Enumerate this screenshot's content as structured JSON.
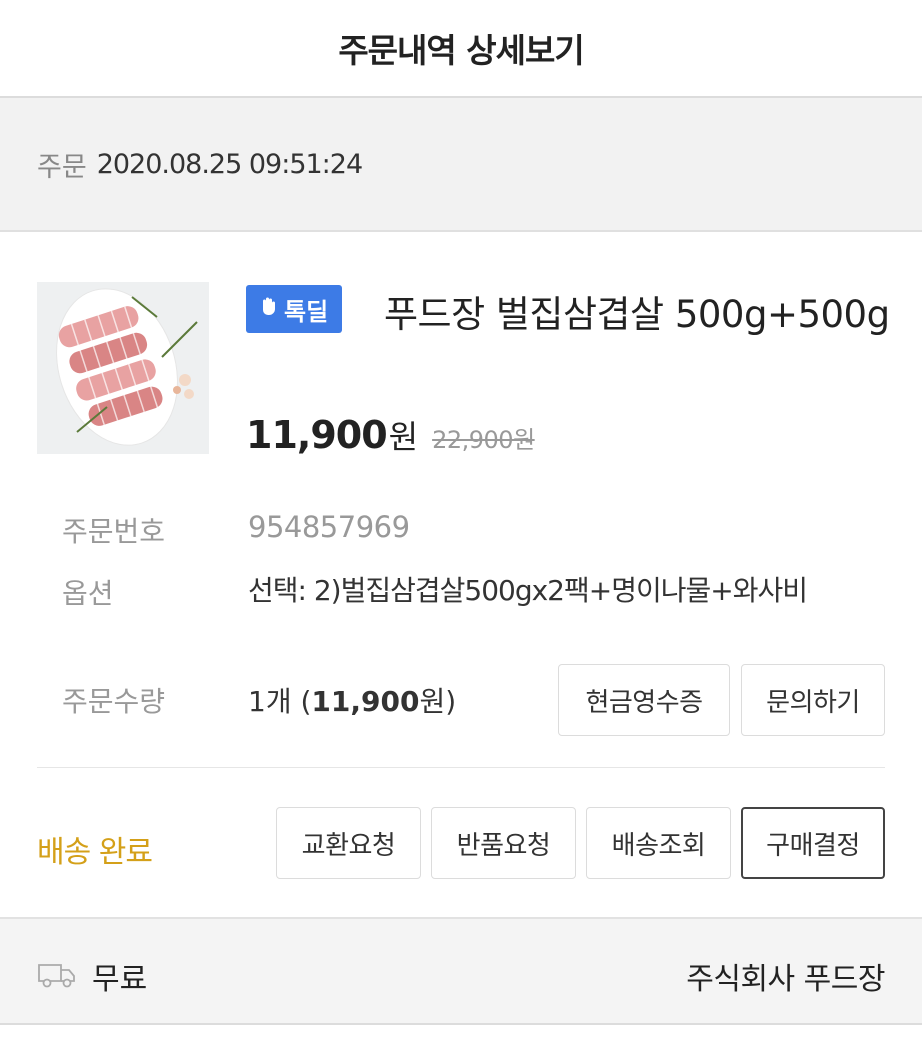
{
  "header": {
    "title": "주문내역 상세보기"
  },
  "order": {
    "label": "주문",
    "datetime": "2020.08.25 09:51:24"
  },
  "product": {
    "image_icon": "pork-belly-image",
    "badge_icon": "waving-hand-icon",
    "badge_label": "톡딜",
    "name": "푸드장 벌집삼겹살 500g+500g",
    "price": "11,900",
    "price_unit": "원",
    "original_price": "22,900원"
  },
  "details": {
    "order_number_label": "주문번호",
    "order_number": "954857969",
    "option_label": "옵션",
    "option_value": "선택: 2)벌집삼겹살500gx2팩+명이나물+와사비",
    "quantity_label": "주문수량",
    "quantity_prefix": "1개 (",
    "quantity_amount": "11,900",
    "quantity_suffix": "원)"
  },
  "buttons": {
    "cash_receipt": "현금영수증",
    "inquiry": "문의하기",
    "exchange": "교환요청",
    "return": "반품요청",
    "tracking": "배송조회",
    "confirm": "구매결정"
  },
  "delivery": {
    "status": "배송 완료",
    "status_color": "#d4a019",
    "shipping_icon": "truck-icon",
    "shipping_fee": "무료",
    "seller": "주식회사 푸드장"
  },
  "colors": {
    "badge": "#3d7be6"
  }
}
